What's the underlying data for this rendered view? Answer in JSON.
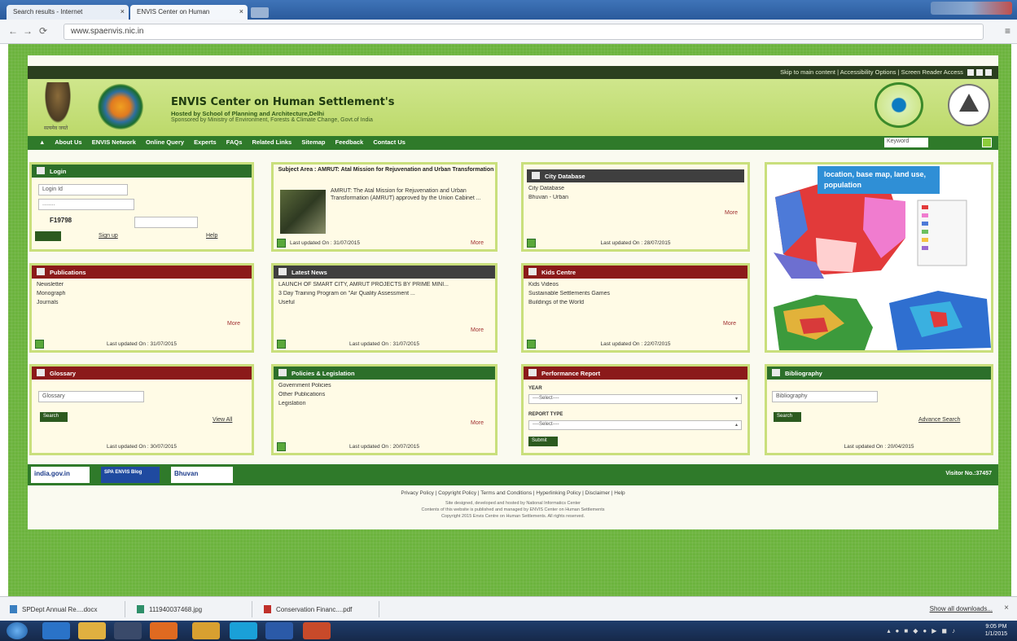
{
  "browser": {
    "tabs": [
      {
        "label": "Search results - Internet"
      },
      {
        "label": "ENVIS Center on Human"
      }
    ],
    "url": "www.spaenvis.nic.in"
  },
  "topbar": {
    "links": "Skip to main content  |  Accessibility Options  |  Screen Reader Access"
  },
  "header": {
    "title": "ENVIS Center on Human Settlement's",
    "hosted": "Hosted by School of Planning and Architecture,Delhi",
    "sponsor": "Sponsored by Ministry of Environment, Forests & Climate Change, Govt.of India",
    "emblem_caption": "सत्यमेव जयते"
  },
  "nav": {
    "items": [
      "About Us",
      "ENVIS Network",
      "Online Query",
      "Experts",
      "FAQs",
      "Related Links",
      "Sitemap",
      "Feedback",
      "Contact Us"
    ],
    "search_value": "Keyword"
  },
  "login": {
    "title": "Login",
    "login_id": "Login Id",
    "password": "........",
    "captcha": "F19798",
    "captcha_input": "",
    "signup": "Sign up",
    "help": "Help"
  },
  "subject": {
    "title": "Subject Area : AMRUT: Atal Mission for Rejuvenation and Urban Transformation",
    "text": "AMRUT: The Atal Mission for Rejuvenation and Urban Transformation (AMRUT) approved by the Union Cabinet ...",
    "updated": "Last updated On : 31/07/2015",
    "more": "More"
  },
  "city": {
    "title": "City Database",
    "items": [
      "City Database",
      "Bhuvan - Urban"
    ],
    "more": "More",
    "updated": "Last updated On : 28/07/2015"
  },
  "map": {
    "label": "location, base map, land use, population"
  },
  "publications": {
    "title": "Publications",
    "items": [
      "Newsletter",
      "Monograph",
      "Journals"
    ],
    "more": "More",
    "updated": "Last updated On : 31/07/2015"
  },
  "news": {
    "title": "Latest News",
    "items": [
      "LAUNCH OF SMART CITY, AMRUT PROJECTS BY PRIME MINI...",
      "3 Day Training Program on \"Air Quality Assessment ...",
      "Useful"
    ],
    "more": "More",
    "updated": "Last updated On : 31/07/2015"
  },
  "kids": {
    "title": "Kids Centre",
    "items": [
      "Kids Videos",
      "Sustainable Settlements Games",
      "Buildings of the World"
    ],
    "more": "More",
    "updated": "Last updated On : 22/07/2015"
  },
  "glossary": {
    "title": "Glossary",
    "input": "Glossary",
    "search": "Search",
    "viewall": "View All",
    "updated": "Last updated On : 30/07/2015"
  },
  "policies": {
    "title": "Policies & Legislation",
    "items": [
      "Government Policies",
      "Other Publications",
      "Legislation"
    ],
    "more": "More",
    "updated": "Last updated On : 20/07/2015"
  },
  "performance": {
    "title": "Performance Report",
    "year_label": "YEAR",
    "year_value": "----Select----",
    "type_label": "REPORT TYPE",
    "type_value": "----Select----",
    "submit": "Submit"
  },
  "bibliography": {
    "title": "Bibliography",
    "input": "Bibliography",
    "search": "Search",
    "advance": "Advance Search",
    "updated": "Last updated On : 20/04/2015"
  },
  "footer": {
    "badges": [
      "india.gov.in",
      "SPA ENVIS Blog",
      "Bhuvan"
    ],
    "visitor": "Visitor No.:37457",
    "links": "Privacy Policy  |  Copyright Policy  |  Terms and Conditions  |  Hyperlinking Policy  |  Disclaimer  |  Help",
    "note1": "Site designed, developed and hosted by National Informatics Center",
    "note2": "Contents of this website is published and managed by ENVIS Center on Human Settlements",
    "note3": "Copyright 2015 Envis Centre on Human Settlements. All rights reserved."
  },
  "downloads": {
    "items": [
      "SPDept Annual Re....docx",
      "111940037468.jpg",
      "Conservation Financ....pdf"
    ],
    "show_all": "Show all downloads..."
  },
  "clock": {
    "time": "9:05 PM",
    "date": "1/1/2015"
  }
}
